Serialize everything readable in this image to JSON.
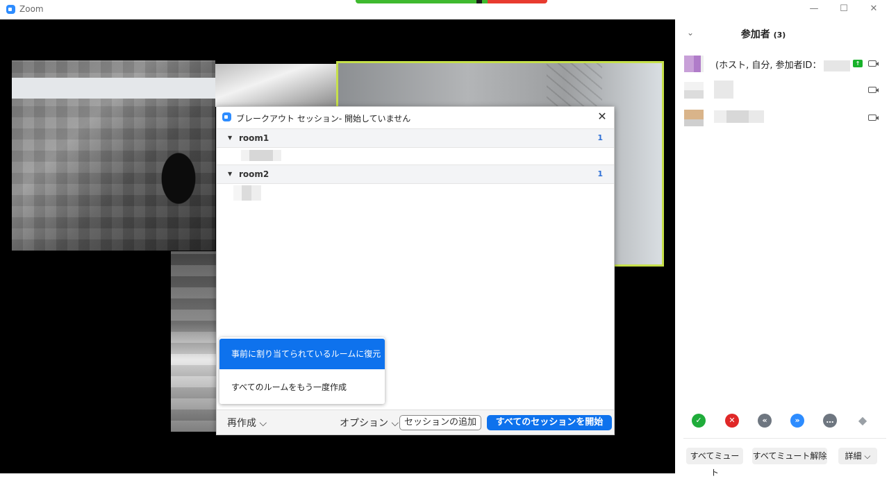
{
  "window": {
    "app_title": "Zoom",
    "minimize_glyph": "—",
    "maximize_glyph": "☐",
    "close_glyph": "✕"
  },
  "breakout_dialog": {
    "title": "ブレークアウト セッション- 開始していません",
    "close_glyph": "✕",
    "rooms": [
      {
        "name": "room1",
        "count": "1"
      },
      {
        "name": "room2",
        "count": "1"
      }
    ],
    "footer": {
      "recreate_label": "再作成 ⌵",
      "options_label": "オプション ⌵",
      "add_session_label": "セッションの追加",
      "start_all_label": "すべてのセッションを開始"
    },
    "recreate_menu": [
      "事前に割り当てられているルームに復元",
      "すべてのルームをもう一度作成"
    ]
  },
  "participants_panel": {
    "title": "参加者",
    "count": "(3)",
    "collapse_glyph": "⌄",
    "participants": [
      {
        "name": "(ホスト, 自分, 参加者ID：",
        "avatar_color": "#c8a0d8",
        "sharing": true
      },
      {
        "name": "",
        "avatar_color": "#e8e8e8",
        "sharing": false
      },
      {
        "name": "",
        "avatar_color": "#d9b48a",
        "sharing": false
      }
    ],
    "reactions": [
      {
        "icon": "check-icon",
        "glyph": "✓",
        "color": "#1fac3a"
      },
      {
        "icon": "cross-icon",
        "glyph": "✕",
        "color": "#e02828"
      },
      {
        "icon": "slower-icon",
        "glyph": "«",
        "color": "#6e7680"
      },
      {
        "icon": "faster-icon",
        "glyph": "»",
        "color": "#2d8cff"
      },
      {
        "icon": "more-icon",
        "glyph": "…",
        "color": "#6e7680"
      },
      {
        "icon": "clear-icon",
        "glyph": "◆",
        "color": "#9aa0a6"
      }
    ],
    "buttons": {
      "mute_all": "すべてミュート",
      "unmute_all": "すべてミュート解除",
      "more": "詳細 ⌵"
    }
  }
}
